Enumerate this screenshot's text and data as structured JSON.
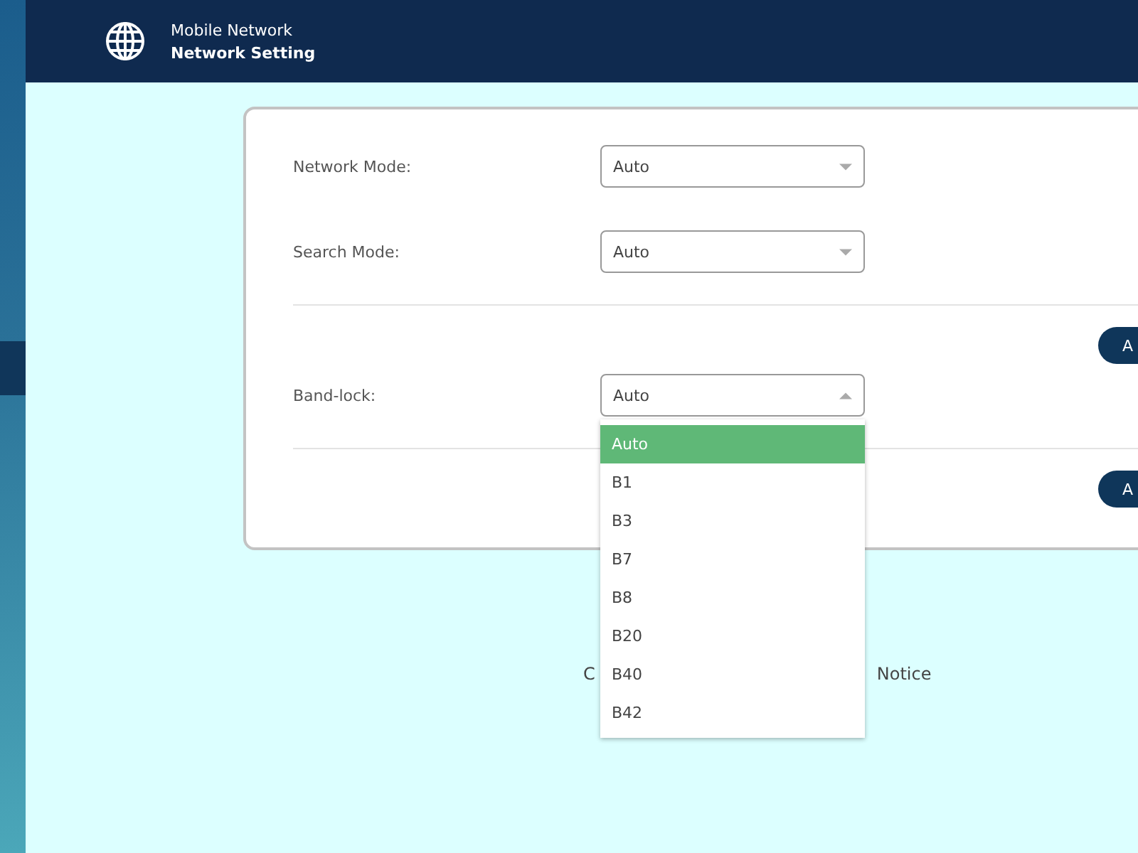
{
  "header": {
    "section": "Mobile Network",
    "title": "Network Setting"
  },
  "card": {
    "sections": [
      {
        "fields": [
          {
            "label": "Network Mode:",
            "value": "Auto",
            "open": false
          },
          {
            "label": "Search Mode:",
            "value": "Auto",
            "open": false
          }
        ],
        "button": "A"
      },
      {
        "fields": [
          {
            "label": "Band-lock:",
            "value": "Auto",
            "open": true,
            "options": [
              {
                "label": "Auto",
                "selected": true
              },
              {
                "label": "B1",
                "selected": false
              },
              {
                "label": "B3",
                "selected": false
              },
              {
                "label": "B7",
                "selected": false
              },
              {
                "label": "B8",
                "selected": false
              },
              {
                "label": "B20",
                "selected": false
              },
              {
                "label": "B40",
                "selected": false
              },
              {
                "label": "B42",
                "selected": false
              }
            ]
          }
        ],
        "button": "A"
      }
    ]
  },
  "footer": {
    "text_start": "C",
    "text_end": "Notice"
  }
}
